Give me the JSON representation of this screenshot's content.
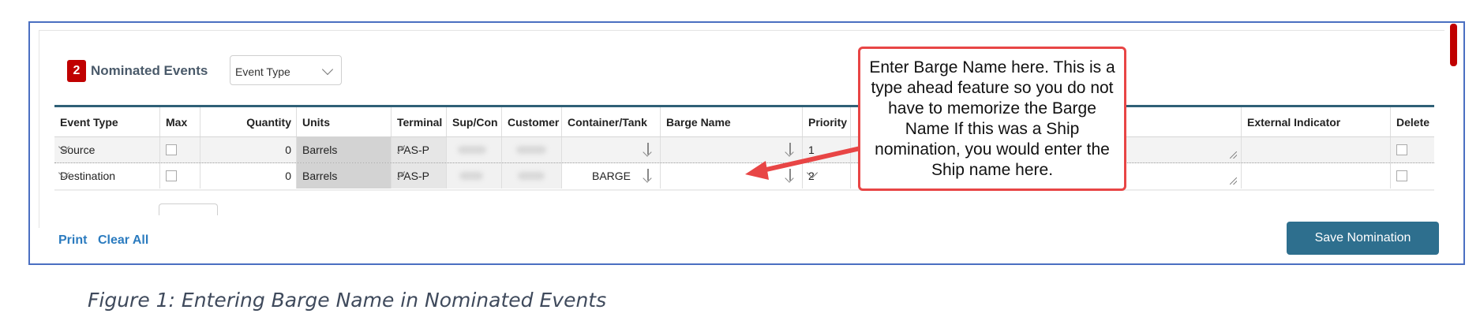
{
  "header": {
    "count": "2",
    "title": "Nominated Events",
    "event_type_select": "Event Type"
  },
  "table": {
    "columns": [
      "Event Type",
      "Max",
      "Quantity",
      "Units",
      "Terminal",
      "Sup/Con",
      "Customer",
      "Container/Tank",
      "Barge Name",
      "Priority",
      "External Indicator",
      "Delete"
    ],
    "rows": [
      {
        "event_type": "Source",
        "quantity": "0",
        "units": "Barrels",
        "terminal": "PAS-P",
        "container": "",
        "barge_name": "",
        "priority": "1"
      },
      {
        "event_type": "Destination",
        "quantity": "0",
        "units": "Barrels",
        "terminal": "PAS-P",
        "container": "BARGE",
        "barge_name": "",
        "priority": "2"
      }
    ]
  },
  "callout": {
    "text": "Enter Barge Name here. This is a type ahead feature so you do not have to memorize the Barge Name If this was a Ship nomination, you would enter the Ship name here."
  },
  "footer": {
    "print_label": "Print",
    "clear_all_label": "Clear All",
    "save_label": "Save Nomination"
  },
  "caption": "Figure 1: Entering Barge Name in Nominated Events",
  "colors": {
    "badge": "#c00000",
    "table_header_border": "#2f6077",
    "save_button": "#2e6f8e",
    "link": "#2b7bbf",
    "callout_border": "#e84545",
    "frame_border": "#4a6fc1"
  }
}
